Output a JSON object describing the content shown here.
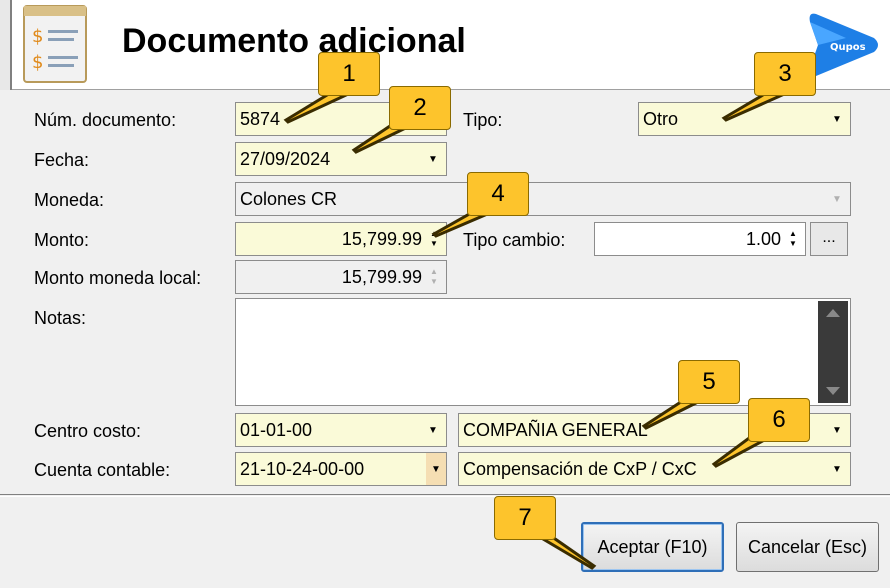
{
  "window": {
    "title": "Documento adicional"
  },
  "logo": {
    "text": "Qupos",
    "color": "#1e7fe6"
  },
  "form": {
    "num_documento": {
      "label": "Núm. documento:",
      "value": "5874"
    },
    "tipo": {
      "label": "Tipo:",
      "value": "Otro"
    },
    "fecha": {
      "label": "Fecha:",
      "value": "27/09/2024"
    },
    "moneda": {
      "label": "Moneda:",
      "value": "Colones CR"
    },
    "monto": {
      "label": "Monto:",
      "value": "15,799.99"
    },
    "tipo_cambio": {
      "label": "Tipo cambio:",
      "value": "1.00",
      "button": "..."
    },
    "monto_local": {
      "label": "Monto moneda local:",
      "value": "15,799.99"
    },
    "notas": {
      "label": "Notas:",
      "value": ""
    },
    "centro_costo": {
      "label": "Centro costo:",
      "code": "01-01-00",
      "name": "COMPAÑIA GENERAL"
    },
    "cuenta_contable": {
      "label": "Cuenta contable:",
      "code": "21-10-24-00-00",
      "name": "Compensación de CxP / CxC"
    }
  },
  "buttons": {
    "accept": "Aceptar (F10)",
    "cancel": "Cancelar (Esc)"
  },
  "callouts": [
    "1",
    "2",
    "3",
    "4",
    "5",
    "6",
    "7"
  ],
  "colors": {
    "field_highlight": "#fafad8",
    "callout": "#fdc42c",
    "accent": "#2f6fb8"
  }
}
